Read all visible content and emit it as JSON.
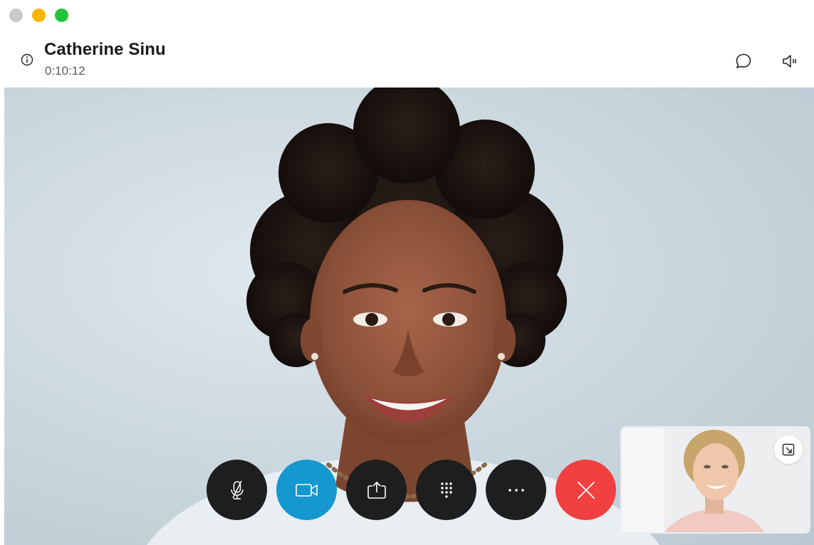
{
  "window": {
    "traffic_lights": {
      "close": "#c9c9c9",
      "minimize": "#f8b600",
      "maximize": "#20c43a"
    }
  },
  "header": {
    "caller_name": "Catherine Sinu",
    "call_duration": "0:10:12",
    "icons": [
      "info-icon",
      "chat-icon",
      "volume-icon"
    ]
  },
  "video": {
    "main_participant": "Catherine Sinu",
    "self_view_controls": [
      "minimize-icon"
    ]
  },
  "controls": {
    "buttons": [
      {
        "name": "mute",
        "icon": "microphone-muted-icon",
        "color": "#1e1e1e"
      },
      {
        "name": "video",
        "icon": "video-camera-icon",
        "color": "#1597cf"
      },
      {
        "name": "share",
        "icon": "share-screen-icon",
        "color": "#1e1e1e"
      },
      {
        "name": "keypad",
        "icon": "keypad-icon",
        "color": "#1e1e1e"
      },
      {
        "name": "more",
        "icon": "more-icon",
        "color": "#1e1e1e"
      },
      {
        "name": "end-call",
        "icon": "close-icon",
        "color": "#f14040"
      }
    ]
  },
  "colors": {
    "accent": "#1597cf",
    "end_call": "#f14040",
    "button_dark": "#1e1e1e"
  }
}
